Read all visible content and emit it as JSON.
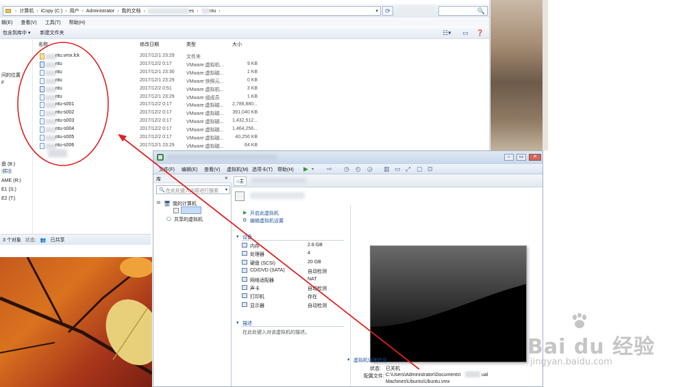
{
  "explorer": {
    "address": [
      "计算机",
      "iCopy (C:)",
      "用户",
      "Administrator",
      "我的文档",
      "es",
      "ntu"
    ],
    "search_glyph": "🔍",
    "menu": [
      "辑(E)",
      "查看(V)",
      "工具(T)",
      "帮助(H)"
    ],
    "toolbar": {
      "include_label": "包含到库中 ▾",
      "new_folder_label": "新建文件夹"
    },
    "columns": {
      "name": "名称",
      "date": "修改日期",
      "type": "类型",
      "size": "大小"
    },
    "files": [
      {
        "name": "ntu.vmx.lck",
        "date": "2017/12/1 23:29",
        "type": "文件夹",
        "size": "",
        "icon": "lck"
      },
      {
        "name": "ntu",
        "date": "2017/12/2 0:17",
        "type": "VMware 虚拟机...",
        "size": "9 KB",
        "icon": "vm"
      },
      {
        "name": "ntu",
        "date": "2017/12/1 23:30",
        "type": "VMware 虚拟磁...",
        "size": "1 KB",
        "icon": "disk"
      },
      {
        "name": "ntu",
        "date": "2017/12/1 23:29",
        "type": "VMware 快照元...",
        "size": "0 KB",
        "icon": "file"
      },
      {
        "name": "ntu",
        "date": "2017/12/2 0:51",
        "type": "VMware 虚拟机...",
        "size": "3 KB",
        "icon": "vm"
      },
      {
        "name": "ntu",
        "date": "2017/12/1 23:29",
        "type": "VMware 组成员",
        "size": "1 KB",
        "icon": "file"
      },
      {
        "name": "ntu-s001",
        "date": "2017/12/2 0:17",
        "type": "VMware 虚拟磁...",
        "size": "2,786,880...",
        "icon": "disk"
      },
      {
        "name": "ntu-s002",
        "date": "2017/12/2 0:17",
        "type": "VMware 虚拟磁...",
        "size": "391,040 KB",
        "icon": "disk"
      },
      {
        "name": "ntu-s003",
        "date": "2017/12/2 0:17",
        "type": "VMware 虚拟磁...",
        "size": "1,432,512...",
        "icon": "disk"
      },
      {
        "name": "ntu-s004",
        "date": "2017/12/2 0:17",
        "type": "VMware 虚拟磁...",
        "size": "1,464,256...",
        "icon": "disk"
      },
      {
        "name": "ntu-s005",
        "date": "2017/12/2 0:17",
        "type": "VMware 虚拟磁...",
        "size": "40,256 KB",
        "icon": "disk"
      },
      {
        "name": "ntu-s006",
        "date": "2017/12/1 23:29",
        "type": "VMware 虚拟磁...",
        "size": "64 KB",
        "icon": "disk"
      }
    ],
    "nav": [
      "问的位置",
      "F",
      "盘 (B:)",
      "(C:)",
      "AME (R:)",
      "E1 (S:)",
      "E2 (T:)"
    ],
    "status": {
      "count": "3 个对象",
      "state_label": "状态:",
      "state_value": "已共享"
    }
  },
  "vmware": {
    "menu": [
      "文件(F)",
      "编辑(E)",
      "查看(V)",
      "虚拟机(M)",
      "选项卡(T)",
      "帮助(H)"
    ],
    "library": {
      "title": "库",
      "close": "×",
      "search_placeholder": "在此处键入内容进行搜索",
      "my_computer": "我的计算机",
      "shared": "共享的虚拟机"
    },
    "tab_home": "主",
    "actions": {
      "start": "开启此虚拟机",
      "edit": "编辑虚拟机设置"
    },
    "devices_title": "设备",
    "devices": [
      {
        "label": "内存",
        "value": "2.8 GB"
      },
      {
        "label": "处理器",
        "value": "4"
      },
      {
        "label": "硬盘 (SCSI)",
        "value": "20 GB"
      },
      {
        "label": "CD/DVD (SATA)",
        "value": "自动检测"
      },
      {
        "label": "网络适配器",
        "value": "NAT"
      },
      {
        "label": "声卡",
        "value": "自动检测"
      },
      {
        "label": "打印机",
        "value": "存在"
      },
      {
        "label": "显示器",
        "value": "自动检测"
      }
    ],
    "description_title": "描述",
    "description_hint": "在此处键入对该虚拟机的描述。",
    "details_title": "虚拟机详细信息",
    "details": {
      "status_label": "状态:",
      "status_value": "已关机",
      "config_label": "配置文件:",
      "config_line1": "C:\\Users\\Administrator\\Documents\\",
      "config_suffix": "ual",
      "config_line2": "Machines\\Ubuntu\\Ubuntu.vmx"
    }
  },
  "watermark": {
    "brand": "Bai du 经验",
    "url": "jingyan.baidu.com"
  },
  "colors": {
    "annotation_red": "#e02020",
    "link_blue": "#1e4e9a"
  }
}
